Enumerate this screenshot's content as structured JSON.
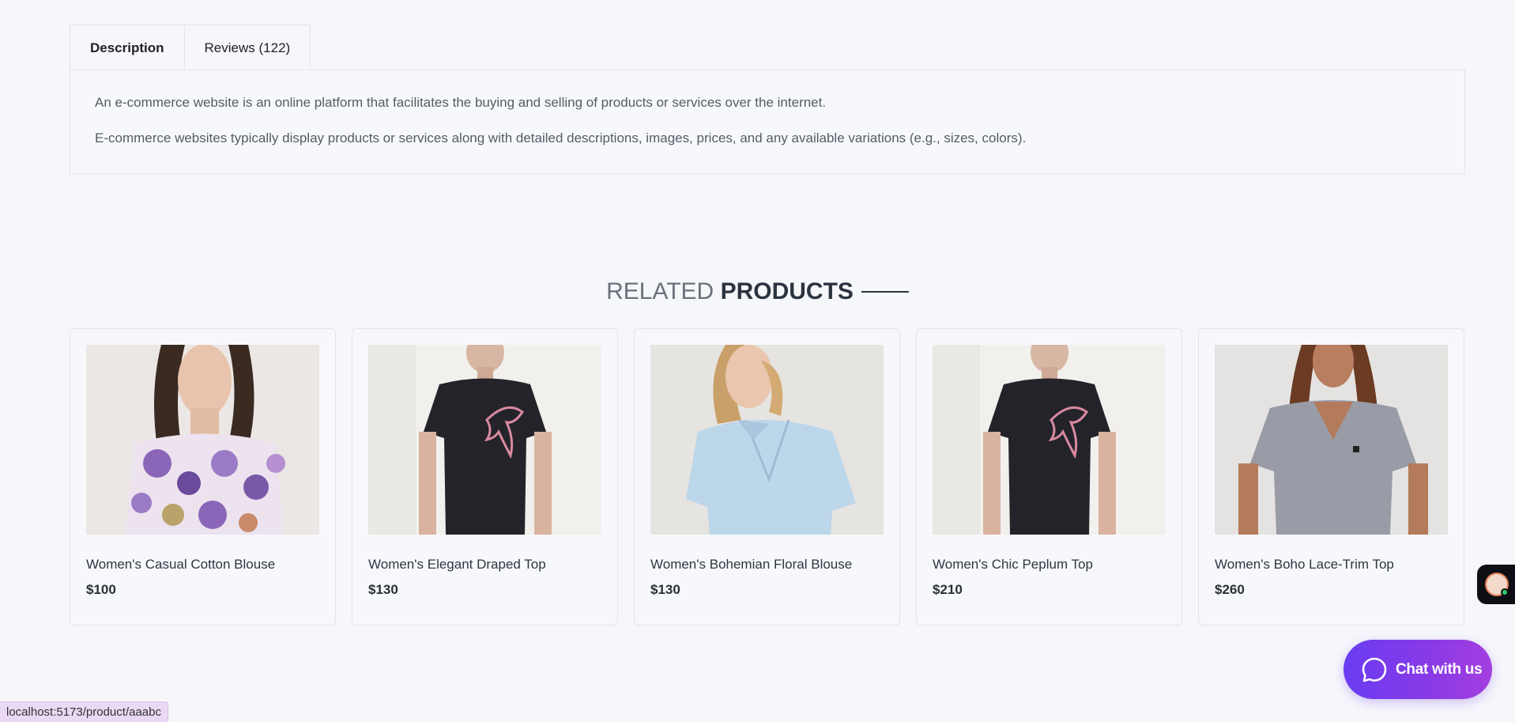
{
  "tabs": [
    {
      "label": "Description",
      "active": true
    },
    {
      "label": "Reviews (122)",
      "active": false
    }
  ],
  "description": {
    "paragraph_1": "An e-commerce website is an online platform that facilitates the buying and selling of products or services over the internet.",
    "paragraph_2": "E-commerce websites typically display products or services along with detailed descriptions, images, prices, and any available variations (e.g., sizes, colors)."
  },
  "related": {
    "heading_light": "RELATED",
    "heading_bold": "PRODUCTS"
  },
  "products": [
    {
      "name": "Women's Casual Cotton Blouse",
      "price": "$100",
      "image": "floral-off-shoulder-top"
    },
    {
      "name": "Women's Elegant Draped Top",
      "price": "$130",
      "image": "black-puma-tee"
    },
    {
      "name": "Women's Bohemian Floral Blouse",
      "price": "$130",
      "image": "light-blue-blouse"
    },
    {
      "name": "Women's Chic Peplum Top",
      "price": "$210",
      "image": "black-puma-tee"
    },
    {
      "name": "Women's Boho Lace-Trim Top",
      "price": "$260",
      "image": "grey-v-neck-tee"
    }
  ],
  "chat": {
    "label": "Chat with us",
    "icon": "chat-bubble-icon"
  },
  "status_bar": {
    "url": "localhost:5173/product/aaabc"
  },
  "colors": {
    "background": "#f6f7fb",
    "chat_gradient_start": "#6a3cf2",
    "chat_gradient_end": "#a33ee0",
    "status_bg": "#ead9f5"
  }
}
